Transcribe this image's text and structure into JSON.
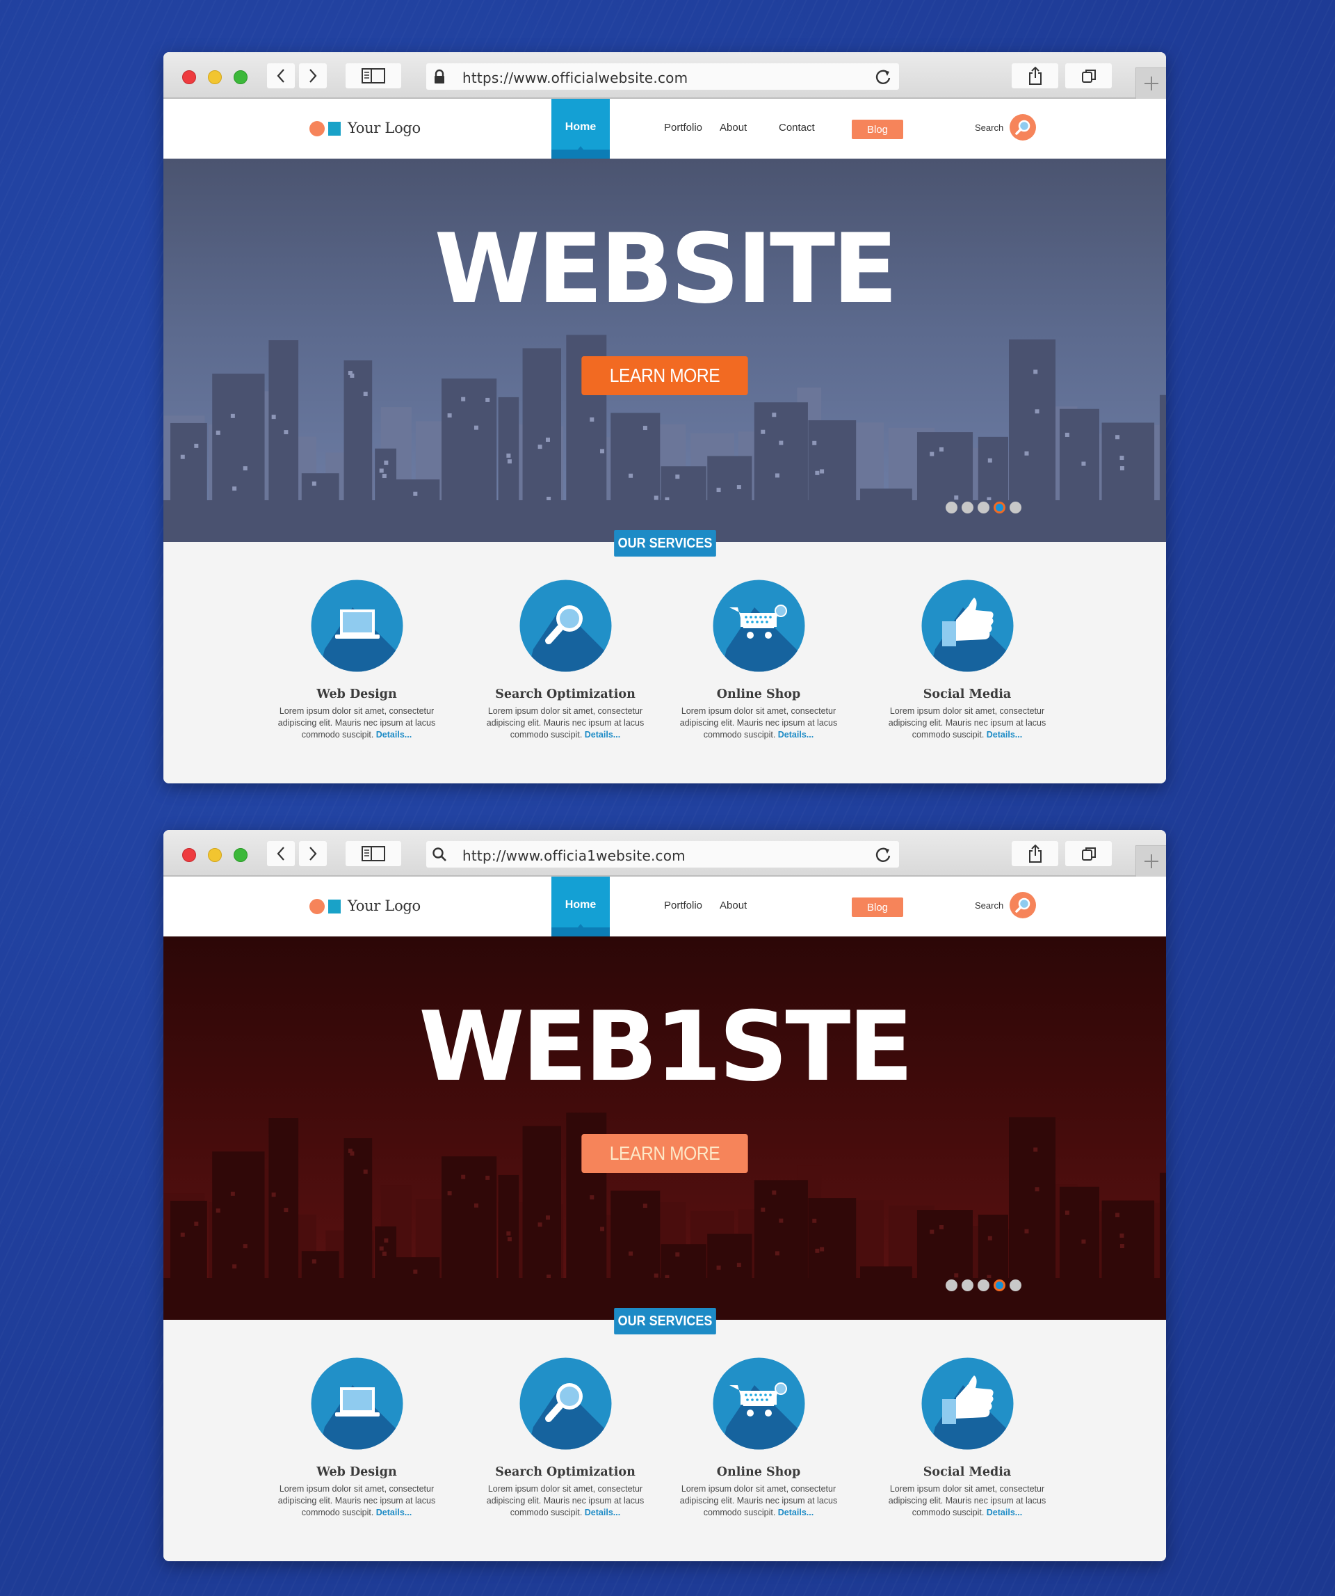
{
  "windows": [
    {
      "toolbar": {
        "url": "https://www.officialwebsite.com",
        "url_icon": "lock-icon"
      },
      "nav": {
        "logo_text": "Your Logo",
        "items": [
          {
            "label": "Home",
            "active": true
          },
          {
            "label": "Portfolio"
          },
          {
            "label": "About"
          },
          {
            "label": "Contact"
          }
        ],
        "blog_label": "Blog",
        "search_label": "Search"
      },
      "hero": {
        "title": "WEBSITE",
        "cta_label": "LEARN MORE",
        "slide_count": 5,
        "active_slide": 4,
        "theme": "night-blue"
      },
      "services": {
        "badge": "OUR SERVICES",
        "items": [
          {
            "title": "Web Design",
            "icon": "laptop-icon",
            "desc": "Lorem ipsum dolor sit amet, consectetur adipiscing elit. Mauris nec ipsum at lacus commodo suscipit.",
            "link": "Details..."
          },
          {
            "title": "Search Optimization",
            "icon": "magnifier-icon",
            "desc": "Lorem ipsum dolor sit amet, consectetur adipiscing elit. Mauris nec ipsum at lacus commodo suscipit.",
            "link": "Details..."
          },
          {
            "title": "Online Shop",
            "icon": "shopping-cart-icon",
            "desc": "Lorem ipsum dolor sit amet, consectetur adipiscing elit. Mauris nec ipsum at lacus commodo suscipit.",
            "link": "Details..."
          },
          {
            "title": "Social Media",
            "icon": "thumbs-up-icon",
            "desc": "Lorem ipsum dolor sit amet, consectetur adipiscing elit. Mauris nec ipsum at lacus commodo suscipit.",
            "link": "Details..."
          }
        ]
      }
    },
    {
      "toolbar": {
        "url": "http://www.officia1website.com",
        "url_icon": "search-icon"
      },
      "nav": {
        "logo_text": "Your Logo",
        "items": [
          {
            "label": "Home",
            "active": true
          },
          {
            "label": "Portfolio"
          },
          {
            "label": "About"
          }
        ],
        "blog_label": "Blog",
        "search_label": "Search"
      },
      "hero": {
        "title": "WEB1STE",
        "cta_label": "LEARN MORE",
        "slide_count": 5,
        "active_slide": 4,
        "theme": "dark-red"
      },
      "services": {
        "badge": "OUR SERVICES",
        "items": [
          {
            "title": "Web Design",
            "icon": "laptop-icon",
            "desc": "Lorem ipsum dolor sit amet, consectetur adipiscing elit. Mauris nec ipsum at lacus commodo suscipit.",
            "link": "Details..."
          },
          {
            "title": "Search Optimization",
            "icon": "magnifier-icon",
            "desc": "Lorem ipsum dolor sit amet, consectetur adipiscing elit. Mauris nec ipsum at lacus commodo suscipit.",
            "link": "Details..."
          },
          {
            "title": "Online Shop",
            "icon": "shopping-cart-icon",
            "desc": "Lorem ipsum dolor sit amet, consectetur adipiscing elit. Mauris nec ipsum at lacus commodo suscipit.",
            "link": "Details..."
          },
          {
            "title": "Social Media",
            "icon": "thumbs-up-icon",
            "desc": "Lorem ipsum dolor sit amet, consectetur adipiscing elit. Mauris nec ipsum at lacus commodo suscipit.",
            "link": "Details..."
          }
        ]
      }
    }
  ],
  "colors": {
    "accent_blue": "#14a0d4",
    "service_blue": "#1d8bc6",
    "orange": "#f26a22",
    "salmon": "#f6845a",
    "page_bg": "#1f3d99"
  }
}
